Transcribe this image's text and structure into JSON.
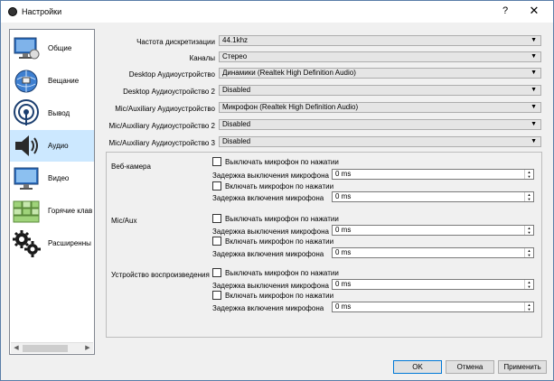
{
  "window": {
    "title": "Настройки",
    "help_glyph": "?",
    "close_glyph": "✕"
  },
  "sidebar": {
    "items": [
      {
        "label": "Общие",
        "icon": "monitor-gear-icon"
      },
      {
        "label": "Вещание",
        "icon": "globe-broadcast-icon"
      },
      {
        "label": "Вывод",
        "icon": "antenna-signal-icon"
      },
      {
        "label": "Аудио",
        "icon": "speaker-icon",
        "active": true
      },
      {
        "label": "Видео",
        "icon": "display-icon"
      },
      {
        "label": "Горячие клав",
        "icon": "keyboard-icon"
      },
      {
        "label": "Расширенны",
        "icon": "gears-icon"
      }
    ],
    "scroll_left": "◀",
    "scroll_right": "▶"
  },
  "audio": {
    "sample_rate": {
      "label": "Частота дискретизации",
      "value": "44.1khz"
    },
    "channels": {
      "label": "Каналы",
      "value": "Стерео"
    },
    "desktop1": {
      "label": "Desktop Аудиоустройство",
      "value": "Динамики (Realtek High Definition Audio)"
    },
    "desktop2": {
      "label": "Desktop Аудиоустройство 2",
      "value": "Disabled"
    },
    "mic1": {
      "label": "Mic/Auxiliary Аудиоустройство",
      "value": "Микрофон (Realtek High Definition Audio)"
    },
    "mic2": {
      "label": "Mic/Auxiliary Аудиоустройство 2",
      "value": "Disabled"
    },
    "mic3": {
      "label": "Mic/Auxiliary Аудиоустройство 3",
      "value": "Disabled"
    }
  },
  "hotkeys": {
    "groups": [
      {
        "name": "Веб-камера"
      },
      {
        "name": "Mic/Aux"
      },
      {
        "name": "Устройство воспроизведения"
      }
    ],
    "push_to_mute": "Выключать микрофон по нажатии",
    "push_to_mute_delay": "Задержка выключения микрофона",
    "push_to_talk": "Включать микрофон по нажатии",
    "push_to_talk_delay": "Задержка включения микрофона",
    "delay_value": "0 ms"
  },
  "buttons": {
    "ok": "OK",
    "cancel": "Отмена",
    "apply": "Применить"
  }
}
